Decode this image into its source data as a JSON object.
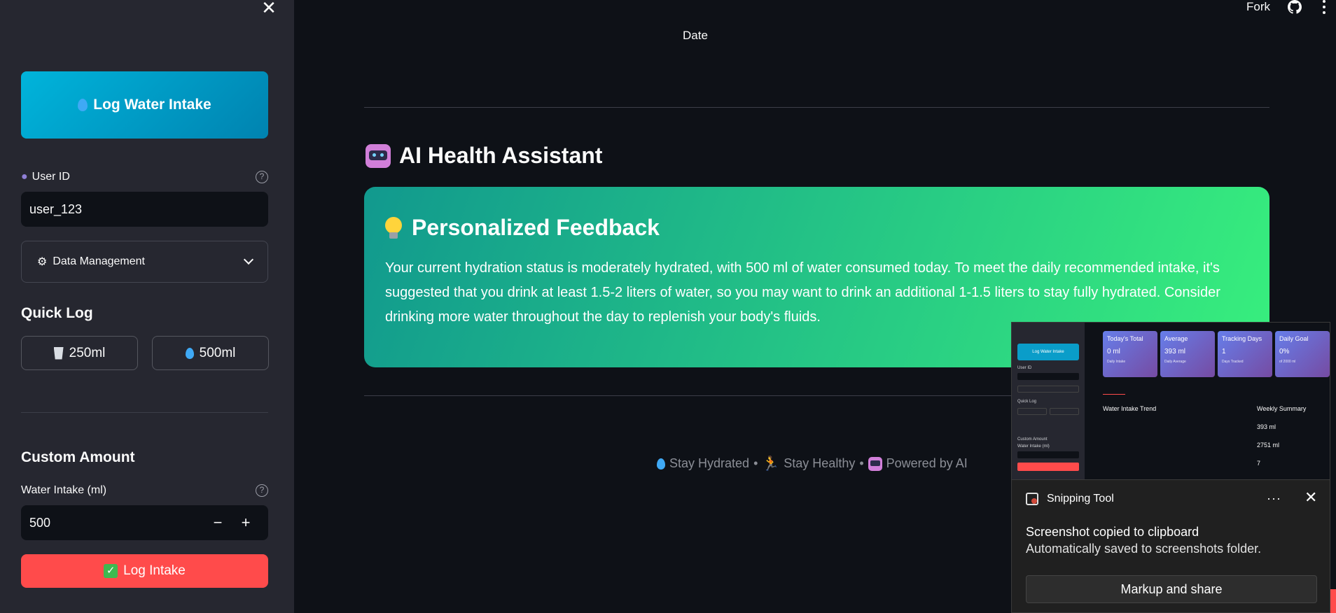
{
  "sidebar": {
    "log_water_button": "Log Water Intake",
    "user_id_label": "User ID",
    "user_id_value": "user_123",
    "data_management_label": "Data Management",
    "quick_log_heading": "Quick Log",
    "quick_250": "250ml",
    "quick_500": "500ml",
    "custom_amount_heading": "Custom Amount",
    "water_intake_label": "Water Intake (ml)",
    "water_intake_value": "500",
    "log_intake_button": "Log Intake"
  },
  "header": {
    "fork_label": "Fork"
  },
  "main": {
    "date_label": "Date",
    "ai_title": "AI Health Assistant",
    "feedback_title": "Personalized Feedback",
    "feedback_text": "Your current hydration status is moderately hydrated, with 500 ml of water consumed today. To meet the daily recommended intake, it's suggested that you drink at least 1.5-2 liters of water, so you may want to drink an additional 1-1.5 liters to stay fully hydrated. Consider drinking more water throughout the day to replenish your body's fluids.",
    "footer": {
      "stay_hydrated": "Stay Hydrated",
      "stay_healthy": "Stay Healthy",
      "powered": "Powered by AI",
      "sep": "•"
    }
  },
  "preview": {
    "cards": [
      {
        "title": "Today's Total",
        "value": "0 ml",
        "sub": "Daily Intake"
      },
      {
        "title": "Average",
        "value": "393 ml",
        "sub": "Daily Average"
      },
      {
        "title": "Tracking Days",
        "value": "1",
        "sub": "Days Tracked"
      },
      {
        "title": "Daily Goal",
        "value": "0%",
        "sub": "of 2000 ml"
      }
    ],
    "trend_title": "Water Intake Trend",
    "weekly_title": "Weekly Summary",
    "weekly_values": [
      "393 ml",
      "2751 ml",
      "7"
    ],
    "side_log_btn": "Log Water Intake",
    "side_quick": "Quick Log",
    "side_custom": "Custom Amount",
    "side_water": "Water Intake (ml)",
    "side_user": "User ID"
  },
  "toast": {
    "app_name": "Snipping Tool",
    "heading": "Screenshot copied to clipboard",
    "subtext": "Automatically saved to screenshots folder.",
    "button": "Markup and share",
    "dots": "···"
  },
  "colors": {
    "sidebar_bg": "#262730",
    "main_bg": "#0e1117",
    "primary_red": "#ff4b4b",
    "feedback_gradient_start": "#11998e",
    "feedback_gradient_end": "#38ef7d"
  }
}
